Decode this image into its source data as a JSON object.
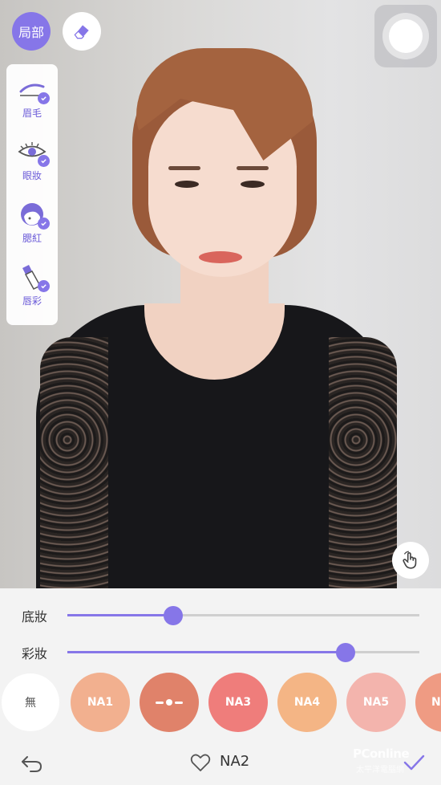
{
  "toolbar": {
    "local_label": "局部",
    "eraser_icon": "eraser-icon",
    "shutter_icon": "shutter-icon",
    "touch_icon": "touch-hand-icon"
  },
  "side_panel": {
    "items": [
      {
        "label": "眉毛",
        "icon": "eyebrow-icon",
        "checked": true
      },
      {
        "label": "眼妝",
        "icon": "eye-icon",
        "checked": true
      },
      {
        "label": "腮紅",
        "icon": "blush-icon",
        "checked": true
      },
      {
        "label": "唇彩",
        "icon": "lipstick-icon",
        "checked": true
      }
    ]
  },
  "sliders": [
    {
      "label": "底妝",
      "value_fraction": 0.3
    },
    {
      "label": "彩妝",
      "value_fraction": 0.79
    }
  ],
  "swatches": [
    {
      "label": "無",
      "color": "#ffffff"
    },
    {
      "label": "NA1",
      "color": "#f2b08f"
    },
    {
      "label": "",
      "color": "#e0826a",
      "icon": "dot-line-icon"
    },
    {
      "label": "NA3",
      "color": "#ef7d7b"
    },
    {
      "label": "NA4",
      "color": "#f4b585"
    },
    {
      "label": "NA5",
      "color": "#f3b4ad"
    },
    {
      "label": "N",
      "color": "#ef9b83"
    }
  ],
  "bottom_bar": {
    "back_icon": "undo-arrow-icon",
    "favorite_icon": "heart-icon",
    "current_name": "NA2",
    "confirm_icon": "checkmark-icon",
    "watermark": "PConline",
    "watermark_sub": "太平洋電腦網"
  },
  "colors": {
    "accent": "#8676e8"
  }
}
